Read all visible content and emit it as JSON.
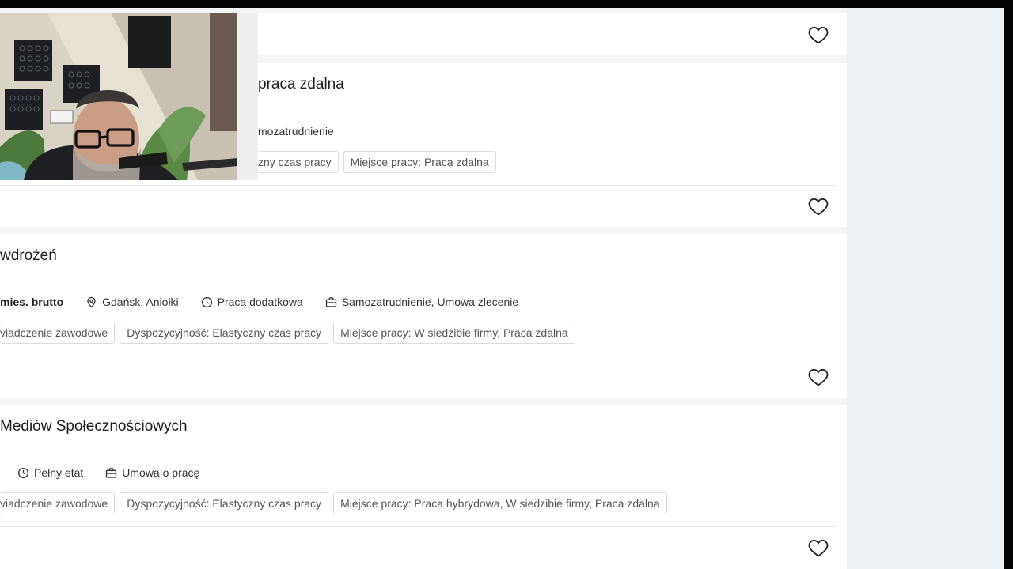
{
  "cards": [
    {
      "title": "",
      "meta": [],
      "tags": []
    },
    {
      "title": "praca zdalna",
      "meta": [
        {
          "icon": "briefcase-icon",
          "text": "mozatrudnienie"
        }
      ],
      "tags": [
        "zny czas pracy",
        "Miejsce pracy: Praca zdalna"
      ]
    },
    {
      "title": "wdrożeń",
      "meta": [
        {
          "icon": "",
          "text": "mies. brutto",
          "bold": true
        },
        {
          "icon": "location-pin-icon",
          "text": "Gdańsk, Aniołki"
        },
        {
          "icon": "clock-icon",
          "text": "Praca dodatkowa"
        },
        {
          "icon": "briefcase-icon",
          "text": "Samozatrudnienie, Umowa zlecenie"
        }
      ],
      "tags": [
        "viadczenie zawodowe",
        "Dyspozycyjność: Elastyczny czas pracy",
        "Miejsce pracy: W siedzibie firmy, Praca zdalna"
      ]
    },
    {
      "title": "Mediów Społecznościowych",
      "meta": [
        {
          "icon": "clock-icon",
          "text": "Pełny etat"
        },
        {
          "icon": "briefcase-icon",
          "text": "Umowa o pracę"
        }
      ],
      "tags": [
        "viadczenie zawodowe",
        "Dyspozycyjność: Elastyczny czas pracy",
        "Miejsce pracy: Praca hybrydowa, W siedzibie firmy, Praca zdalna"
      ]
    }
  ],
  "icons": {
    "favorite": "heart-outline-icon"
  },
  "colors": {
    "page_bg": "#f4f5f6",
    "card_bg": "#ffffff",
    "right_panel": "#eef1f4",
    "tag_border": "#dcdcdc"
  }
}
